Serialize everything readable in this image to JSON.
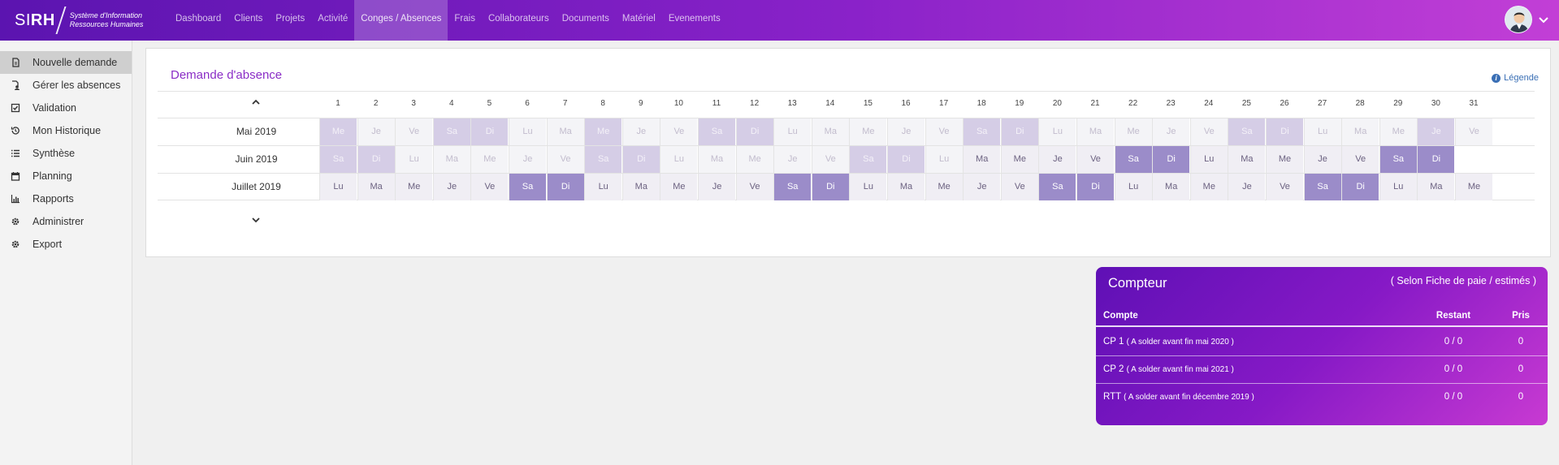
{
  "logo": {
    "brand_light": "SI",
    "brand_bold": "RH",
    "sub_line1": "Système d'Information",
    "sub_line2": "Ressources Humaines"
  },
  "nav": [
    "Dashboard",
    "Clients",
    "Projets",
    "Activité",
    "Conges / Absences",
    "Frais",
    "Collaborateurs",
    "Documents",
    "Matériel",
    "Evenements"
  ],
  "nav_active_index": 4,
  "sidebar": [
    {
      "label": "Nouvelle demande",
      "icon": "file-icon",
      "active": true
    },
    {
      "label": "Gérer les absences",
      "icon": "user-file-icon"
    },
    {
      "label": "Validation",
      "icon": "check-square-icon"
    },
    {
      "label": "Mon Historique",
      "icon": "history-icon"
    },
    {
      "label": "Synthèse",
      "icon": "list-icon"
    },
    {
      "label": "Planning",
      "icon": "calendar-icon"
    },
    {
      "label": "Rapports",
      "icon": "bar-chart-icon"
    },
    {
      "label": "Administrer",
      "icon": "gear-icon"
    },
    {
      "label": "Export",
      "icon": "gear-icon"
    }
  ],
  "absence": {
    "title": "Demande d'absence",
    "legend": "Légende",
    "days": [
      "1",
      "2",
      "3",
      "4",
      "5",
      "6",
      "7",
      "8",
      "9",
      "10",
      "11",
      "12",
      "13",
      "14",
      "15",
      "16",
      "17",
      "18",
      "19",
      "20",
      "21",
      "22",
      "23",
      "24",
      "25",
      "26",
      "27",
      "28",
      "29",
      "30",
      "31"
    ],
    "months": [
      {
        "label": "Mai 2019",
        "state": "past",
        "cells": [
          "Me",
          "Je",
          "Ve",
          "Sa",
          "Di",
          "Lu",
          "Ma",
          "Me",
          "Je",
          "Ve",
          "Sa",
          "Di",
          "Lu",
          "Ma",
          "Me",
          "Je",
          "Ve",
          "Sa",
          "Di",
          "Lu",
          "Ma",
          "Me",
          "Je",
          "Ve",
          "Sa",
          "Di",
          "Lu",
          "Ma",
          "Me",
          "Je",
          "Ve"
        ],
        "highlight": [
          0,
          3,
          4,
          7,
          10,
          11,
          17,
          18,
          24,
          25,
          29
        ]
      },
      {
        "label": "Juin 2019",
        "state": "mixed",
        "current_from": 17,
        "cells": [
          "Sa",
          "Di",
          "Lu",
          "Ma",
          "Me",
          "Je",
          "Ve",
          "Sa",
          "Di",
          "Lu",
          "Ma",
          "Me",
          "Je",
          "Ve",
          "Sa",
          "Di",
          "Lu",
          "Ma",
          "Me",
          "Je",
          "Ve",
          "Sa",
          "Di",
          "Lu",
          "Ma",
          "Me",
          "Je",
          "Ve",
          "Sa",
          "Di"
        ],
        "highlight": [
          0,
          1,
          7,
          8,
          14,
          15,
          21,
          22,
          28,
          29
        ]
      },
      {
        "label": "Juillet 2019",
        "state": "current",
        "cells": [
          "Lu",
          "Ma",
          "Me",
          "Je",
          "Ve",
          "Sa",
          "Di",
          "Lu",
          "Ma",
          "Me",
          "Je",
          "Ve",
          "Sa",
          "Di",
          "Lu",
          "Ma",
          "Me",
          "Je",
          "Ve",
          "Sa",
          "Di",
          "Lu",
          "Ma",
          "Me",
          "Je",
          "Ve",
          "Sa",
          "Di",
          "Lu",
          "Ma",
          "Me"
        ],
        "highlight": [
          5,
          6,
          12,
          13,
          19,
          20,
          26,
          27
        ]
      }
    ]
  },
  "compteur": {
    "title": "Compteur",
    "subtitle": "( Selon Fiche de paie / estimés )",
    "headers": {
      "compte": "Compte",
      "restant": "Restant",
      "pris": "Pris"
    },
    "rows": [
      {
        "name": "CP 1",
        "note": "( A solder avant fin mai 2020 )",
        "restant": "0 / 0",
        "pris": "0"
      },
      {
        "name": "CP 2",
        "note": "( A solder avant fin mai 2021 )",
        "restant": "0 / 0",
        "pris": "0"
      },
      {
        "name": "RTT",
        "note": "( A solder avant fin décembre 2019 )",
        "restant": "0 / 0",
        "pris": "0"
      }
    ]
  }
}
